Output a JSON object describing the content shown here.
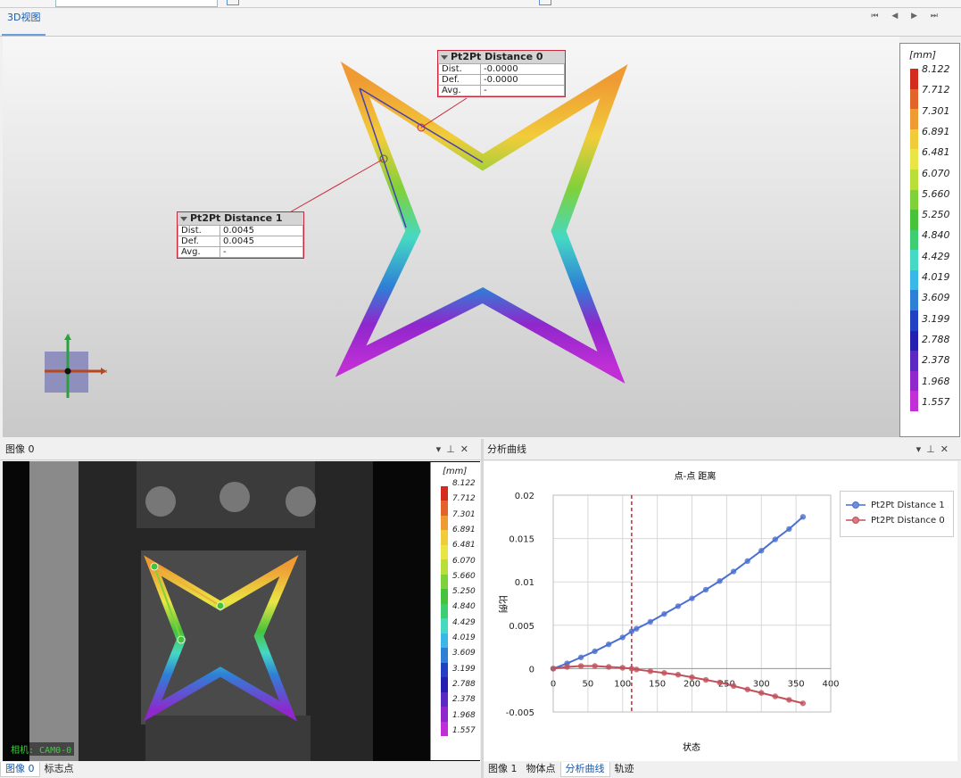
{
  "top_tab": {
    "label": "3D视图"
  },
  "colorscale": {
    "unit": "[mm]",
    "labels": [
      "8.122",
      "7.712",
      "7.301",
      "6.891",
      "6.481",
      "6.070",
      "5.660",
      "5.250",
      "4.840",
      "4.429",
      "4.019",
      "3.609",
      "3.199",
      "2.788",
      "2.378",
      "1.968",
      "1.557"
    ],
    "colors": [
      "#d42b1f",
      "#e2642a",
      "#ef9a33",
      "#f1cc3a",
      "#e9e544",
      "#b9de3a",
      "#7fd13a",
      "#47c33b",
      "#3fcd74",
      "#45d9c3",
      "#39b7e6",
      "#2e80d6",
      "#2241c2",
      "#2520b0",
      "#5b28c2",
      "#8f27cc",
      "#c02fd6"
    ]
  },
  "measure_boxes": [
    {
      "title": "Pt2Pt Distance 0",
      "rows": [
        {
          "key": "Dist.",
          "value": "-0.0000"
        },
        {
          "key": "Def.",
          "value": "-0.0000"
        },
        {
          "key": "Avg.",
          "value": "-"
        }
      ]
    },
    {
      "title": "Pt2Pt Distance 1",
      "rows": [
        {
          "key": "Dist.",
          "value": "0.0045"
        },
        {
          "key": "Def.",
          "value": "0.0045"
        },
        {
          "key": "Avg.",
          "value": "-"
        }
      ]
    }
  ],
  "axis_labels": {
    "x": "x",
    "y": "y"
  },
  "left_panel": {
    "title": "图像 0",
    "camera_label": "相机: CAM0-0",
    "tabs": [
      "图像 0",
      "标志点"
    ]
  },
  "right_panel": {
    "title": "分析曲线",
    "tabs": [
      "图像 1",
      "物体点",
      "分析曲线",
      "轨迹"
    ]
  },
  "panel_controls": {
    "dropdown": "▾",
    "pin": "⊥",
    "close": "✕"
  },
  "nav_buttons": "⏮ ◀ ▶ ⏭",
  "chart_data": {
    "type": "scatter",
    "title": "点-点 距离",
    "xlabel": "状态",
    "ylabel": "比例",
    "xlim": [
      0,
      400
    ],
    "ylim": [
      -0.005,
      0.02
    ],
    "x_ticks": [
      0,
      50,
      100,
      150,
      200,
      250,
      300,
      350,
      400
    ],
    "y_ticks": [
      "0.02",
      "0.015",
      "0.01",
      "0.005",
      "0",
      "-0.005"
    ],
    "vline_x": 113,
    "series": [
      {
        "name": "Pt2Pt Distance 1",
        "color": "#4a6fd0",
        "x": [
          0,
          20,
          40,
          60,
          80,
          100,
          113,
          120,
          140,
          160,
          180,
          200,
          220,
          240,
          260,
          280,
          300,
          320,
          340,
          360
        ],
        "y": [
          0,
          0.0006,
          0.0013,
          0.002,
          0.0028,
          0.0036,
          0.0043,
          0.0046,
          0.0054,
          0.0063,
          0.0072,
          0.0081,
          0.0091,
          0.0101,
          0.0112,
          0.0124,
          0.0136,
          0.0149,
          0.0161,
          0.0175
        ]
      },
      {
        "name": "Pt2Pt Distance 0",
        "color": "#c0505a",
        "x": [
          0,
          20,
          40,
          60,
          80,
          100,
          113,
          120,
          140,
          160,
          180,
          200,
          220,
          240,
          260,
          280,
          300,
          320,
          340,
          360
        ],
        "y": [
          0,
          0.0002,
          0.0003,
          0.0003,
          0.0002,
          0.0001,
          0.0,
          -0.0001,
          -0.0003,
          -0.0005,
          -0.0007,
          -0.001,
          -0.0013,
          -0.0016,
          -0.002,
          -0.0024,
          -0.0028,
          -0.0032,
          -0.0036,
          -0.004
        ]
      }
    ],
    "legend_position": "top-right"
  }
}
